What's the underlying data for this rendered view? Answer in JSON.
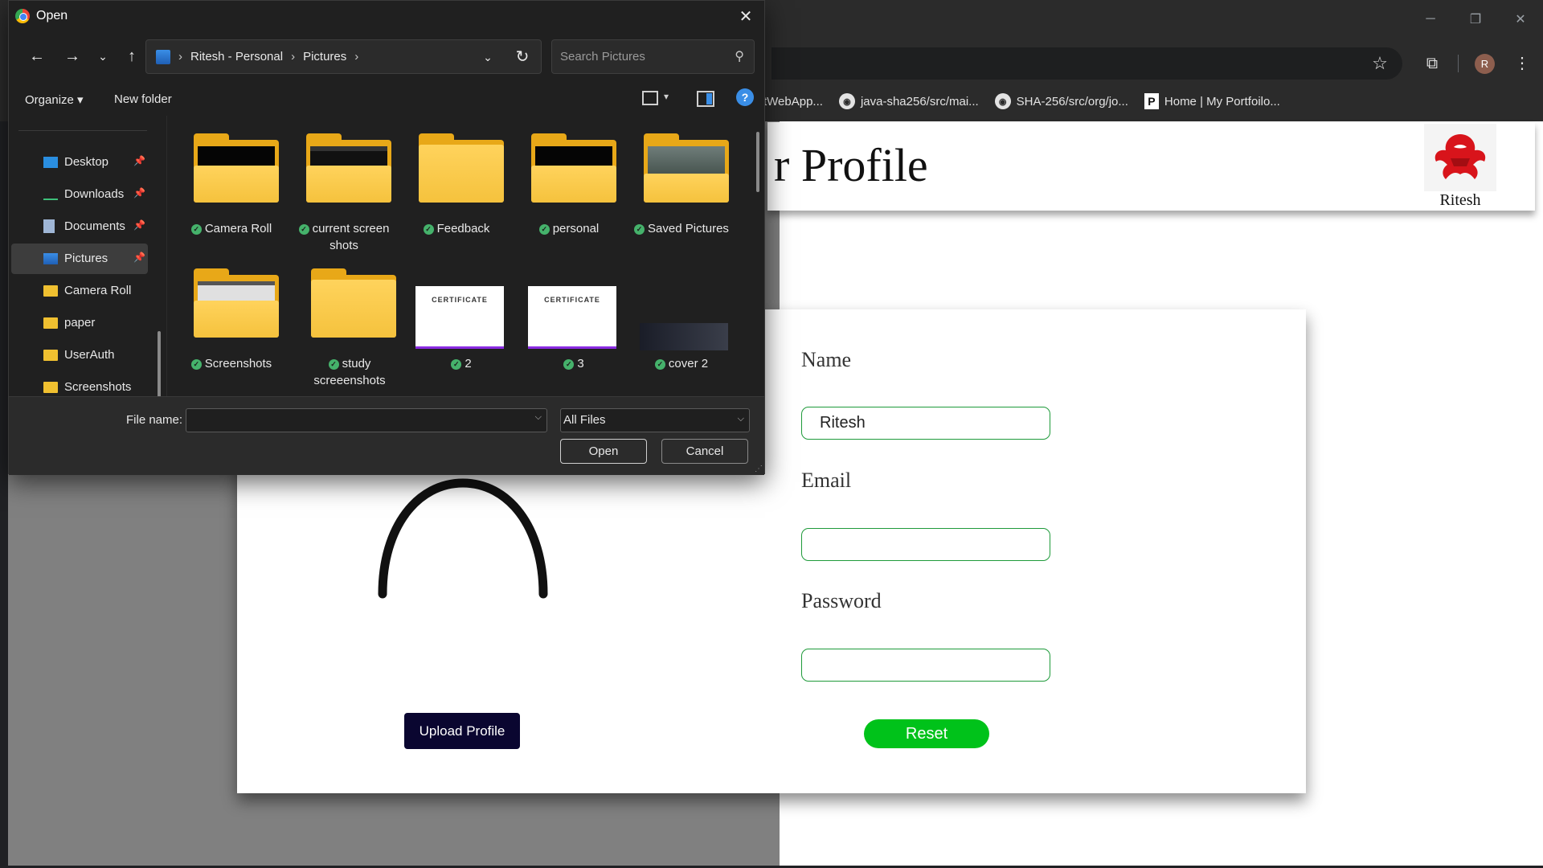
{
  "browser": {
    "window_controls": [
      "─",
      "❐",
      "✕"
    ],
    "avatar_letter": "R",
    "bookmarks": [
      {
        "label": "tWebApp...",
        "icon": "none"
      },
      {
        "label": "java-sha256/src/mai...",
        "icon": "github-icon"
      },
      {
        "label": "SHA-256/src/org/jo...",
        "icon": "github-icon"
      },
      {
        "label": "Home | My Portfoilo...",
        "icon": "portfolio-p-icon"
      }
    ]
  },
  "page": {
    "title_visible": "r Profile",
    "username": "Ritesh",
    "logo_icon": "red-lion-logo-icon",
    "form": {
      "name_label": "Name",
      "name_value": "Ritesh",
      "email_label": "Email",
      "email_value": "",
      "password_label": "Password",
      "password_value": "",
      "reset_label": "Reset"
    },
    "upload_label": "Upload Profile",
    "colors": {
      "upload_bg": "#0a0630",
      "reset_bg": "#00c21a",
      "input_border": "#1e9a3a"
    }
  },
  "dialog": {
    "title": "Open",
    "breadcrumbs": [
      "Ritesh - Personal",
      "Pictures"
    ],
    "search_placeholder": "Search Pictures",
    "organize_label": "Organize ▾",
    "new_folder_label": "New folder",
    "help": "?",
    "sidebar": [
      {
        "label": "Desktop",
        "icon": "desktop-icon",
        "pinned": true,
        "selected": false
      },
      {
        "label": "Downloads",
        "icon": "download-icon",
        "pinned": true,
        "selected": false
      },
      {
        "label": "Documents",
        "icon": "documents-icon",
        "pinned": true,
        "selected": false
      },
      {
        "label": "Pictures",
        "icon": "pictures-icon",
        "pinned": true,
        "selected": true
      },
      {
        "label": "Camera Roll",
        "icon": "folder-icon",
        "pinned": false,
        "selected": false
      },
      {
        "label": "paper",
        "icon": "folder-icon",
        "pinned": false,
        "selected": false
      },
      {
        "label": "UserAuth",
        "icon": "folder-icon",
        "pinned": false,
        "selected": false
      },
      {
        "label": "Screenshots",
        "icon": "folder-icon",
        "pinned": false,
        "selected": false
      }
    ],
    "files": [
      {
        "label": "Camera Roll",
        "kind": "folder",
        "synced": true
      },
      {
        "label": "current screen shots",
        "kind": "folder",
        "synced": true
      },
      {
        "label": "Feedback",
        "kind": "folder",
        "synced": true
      },
      {
        "label": "personal",
        "kind": "folder",
        "synced": true
      },
      {
        "label": "Saved Pictures",
        "kind": "folder",
        "synced": true
      },
      {
        "label": "Screenshots",
        "kind": "folder",
        "synced": true
      },
      {
        "label": "study screeenshots",
        "kind": "folder",
        "synced": true
      },
      {
        "label": "2",
        "kind": "image",
        "synced": true,
        "thumb_text": "CERTIFICATE"
      },
      {
        "label": "3",
        "kind": "image",
        "synced": true,
        "thumb_text": "CERTIFICATE"
      },
      {
        "label": "cover 2",
        "kind": "image",
        "synced": true
      }
    ],
    "file_name_label": "File name:",
    "file_name_value": "",
    "filter_value": "All Files",
    "open_label": "Open",
    "cancel_label": "Cancel"
  }
}
